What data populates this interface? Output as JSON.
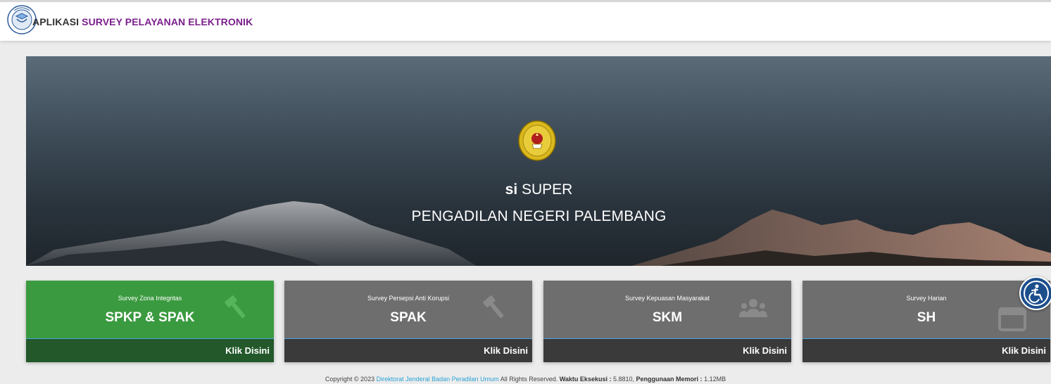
{
  "header": {
    "brand_prefix": "APLIKASI",
    "brand_main": "SURVEY PELAYANAN ELEKTRONIK"
  },
  "hero": {
    "app_short": "si",
    "app_name": "SUPER",
    "institution": "PENGADILAN NEGERI PALEMBANG"
  },
  "cards": [
    {
      "subtitle": "Survey Zona Integritas",
      "title": "SPKP & SPAK",
      "link": "Klik Disini",
      "icon": "gavel-icon",
      "color": "#3a9a3f"
    },
    {
      "subtitle": "Survey Persepsi Anti Korupsi",
      "title": "SPAK",
      "link": "Klik Disini",
      "icon": "gavel-icon",
      "color": "#6e6e6e"
    },
    {
      "subtitle": "Survey Kepuasan Masyarakat",
      "title": "SKM",
      "link": "Klik Disini",
      "icon": "users-icon",
      "color": "#6e6e6e"
    },
    {
      "subtitle": "Survey Harian",
      "title": "SH",
      "link": "Klik Disini",
      "icon": "calendar-icon",
      "color": "#6e6e6e"
    }
  ],
  "footer": {
    "copyright": "Copyright © 2023",
    "org_link": "Direktorat Jenderal Badan Peradilan Umum",
    "rights": "All Rights Reserved.",
    "exec_label": "Waktu Eksekusi :",
    "exec_value": "5.8810,",
    "mem_label": "Penggunaan Memori :",
    "mem_value": "1.12MB"
  },
  "accessibility": {
    "icon": "accessibility-icon"
  }
}
